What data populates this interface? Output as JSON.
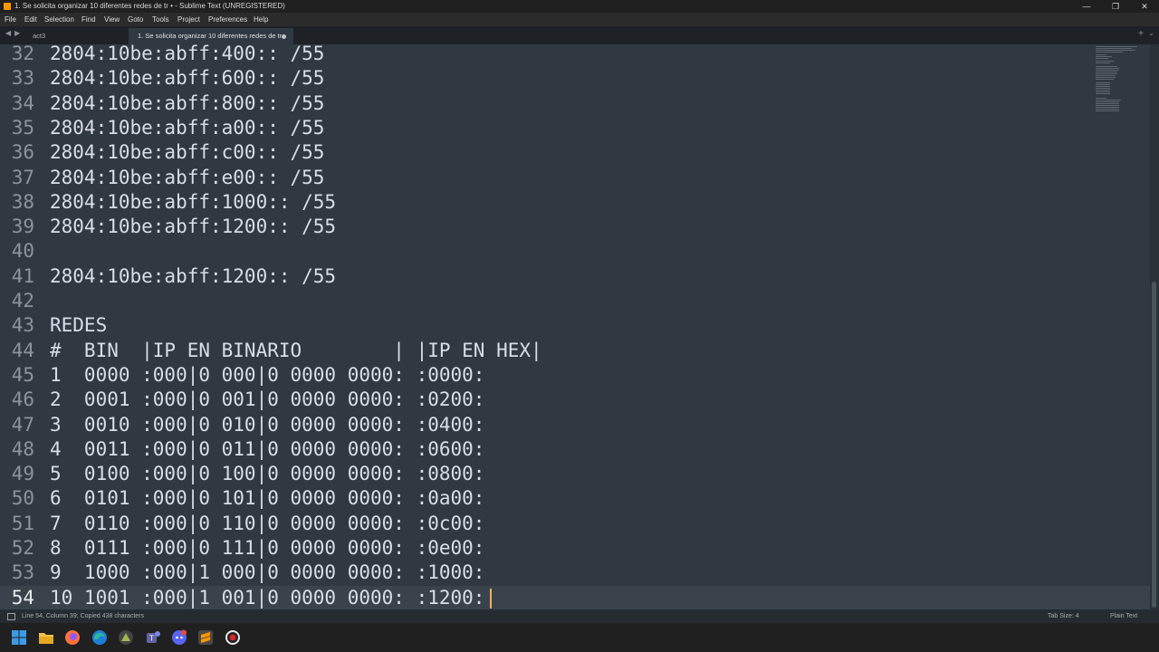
{
  "window": {
    "title": "1. Se solicita organizar 10 diferentes redes de tr • - Sublime Text (UNREGISTERED)",
    "controls": [
      "—",
      "❐",
      "✕"
    ]
  },
  "menu": [
    "File",
    "Edit",
    "Selection",
    "Find",
    "View",
    "Goto",
    "Tools",
    "Project",
    "Preferences",
    "Help"
  ],
  "tabs": {
    "nav_prev": "◀",
    "nav_next": "▶",
    "items": [
      {
        "label": "act3",
        "active": false,
        "modified": false
      },
      {
        "label": "1. Se solicita organizar 10 diferentes redes de tr",
        "active": true,
        "modified": true
      }
    ],
    "new_tab": "+",
    "more": "⌄"
  },
  "editor": {
    "lines": [
      {
        "n": "32",
        "text": "2804:10be:abff:400:: /55"
      },
      {
        "n": "33",
        "text": "2804:10be:abff:600:: /55"
      },
      {
        "n": "34",
        "text": "2804:10be:abff:800:: /55"
      },
      {
        "n": "35",
        "text": "2804:10be:abff:a00:: /55"
      },
      {
        "n": "36",
        "text": "2804:10be:abff:c00:: /55"
      },
      {
        "n": "37",
        "text": "2804:10be:abff:e00:: /55"
      },
      {
        "n": "38",
        "text": "2804:10be:abff:1000:: /55"
      },
      {
        "n": "39",
        "text": "2804:10be:abff:1200:: /55"
      },
      {
        "n": "40",
        "text": ""
      },
      {
        "n": "41",
        "text": "2804:10be:abff:1200:: /55"
      },
      {
        "n": "42",
        "text": ""
      },
      {
        "n": "43",
        "text": "REDES"
      },
      {
        "n": "44",
        "text": "#  BIN  |IP EN BINARIO        | |IP EN HEX|"
      },
      {
        "n": "45",
        "text": "1  0000 :000|0 000|0 0000 0000: :0000:"
      },
      {
        "n": "46",
        "text": "2  0001 :000|0 001|0 0000 0000: :0200:"
      },
      {
        "n": "47",
        "text": "3  0010 :000|0 010|0 0000 0000: :0400:"
      },
      {
        "n": "48",
        "text": "4  0011 :000|0 011|0 0000 0000: :0600:"
      },
      {
        "n": "49",
        "text": "5  0100 :000|0 100|0 0000 0000: :0800:"
      },
      {
        "n": "50",
        "text": "6  0101 :000|0 101|0 0000 0000: :0a00:"
      },
      {
        "n": "51",
        "text": "7  0110 :000|0 110|0 0000 0000: :0c00:"
      },
      {
        "n": "52",
        "text": "8  0111 :000|0 111|0 0000 0000: :0e00:"
      },
      {
        "n": "53",
        "text": "9  1000 :000|1 000|0 0000 0000: :1000:"
      },
      {
        "n": "54",
        "text": "10 1001 :000|1 001|0 0000 0000: :1200:",
        "current": true
      }
    ]
  },
  "status": {
    "message": "Line 54, Column 39; Copied 438 characters",
    "tab_size": "Tab Size: 4",
    "syntax": "Plain Text"
  },
  "taskbar": {
    "items": [
      {
        "name": "windows-start-icon",
        "color": "#3b9be6"
      },
      {
        "name": "file-explorer-icon",
        "color": "#f2c14e"
      },
      {
        "name": "firefox-icon",
        "color": "#ff7139"
      },
      {
        "name": "edge-icon",
        "color": "#2fb5a0"
      },
      {
        "name": "app-icon",
        "color": "#a0b84a"
      },
      {
        "name": "teams-icon",
        "color": "#6264a7"
      },
      {
        "name": "discord-icon",
        "color": "#5865f2"
      },
      {
        "name": "sublime-text-icon",
        "color": "#ff9800"
      },
      {
        "name": "obs-record-icon",
        "color": "#e8e8e8"
      }
    ]
  },
  "colors": {
    "editor_bg": "#303841",
    "text": "#d8dee9",
    "line_number": "#8b949c",
    "cursor": "#f9ae58"
  }
}
